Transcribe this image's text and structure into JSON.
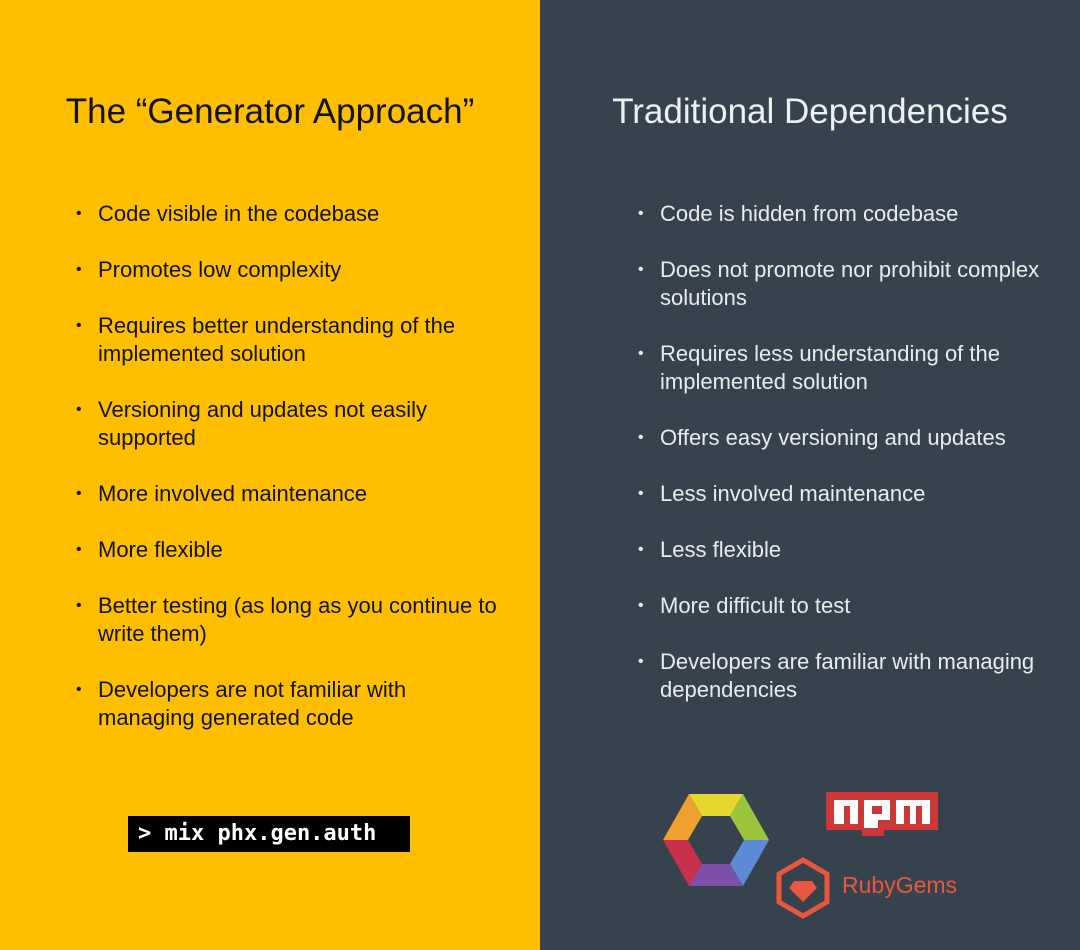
{
  "left": {
    "title": "The “Generator Approach”",
    "points": [
      "Code visible in the codebase",
      "Promotes low complexity",
      "Requires better understanding of the implemented solution",
      "Versioning and updates not easily supported",
      "More involved maintenance",
      "More flexible",
      "Better testing (as long as you continue to write them)",
      "Developers are not familiar with managing generated code"
    ],
    "command": "> mix phx.gen.auth"
  },
  "right": {
    "title": "Traditional Dependencies",
    "points": [
      "Code is hidden from codebase",
      "Does not promote nor prohibit complex solutions",
      "Requires less understanding of the implemented solution",
      "Offers easy versioning and updates",
      "Less involved maintenance",
      "Less flexible",
      "More difficult to test",
      "Developers are familiar with managing dependencies"
    ],
    "logos": {
      "npm": "npm",
      "rubygems": "RubyGems"
    }
  },
  "colors": {
    "left_bg": "#FFBF00",
    "right_bg": "#36434F",
    "ruby_red": "#E9573F",
    "npm_red": "#CB3837"
  },
  "icons": [
    "hexagon-package-icon",
    "npm-logo-icon",
    "rubygems-logo-icon"
  ]
}
